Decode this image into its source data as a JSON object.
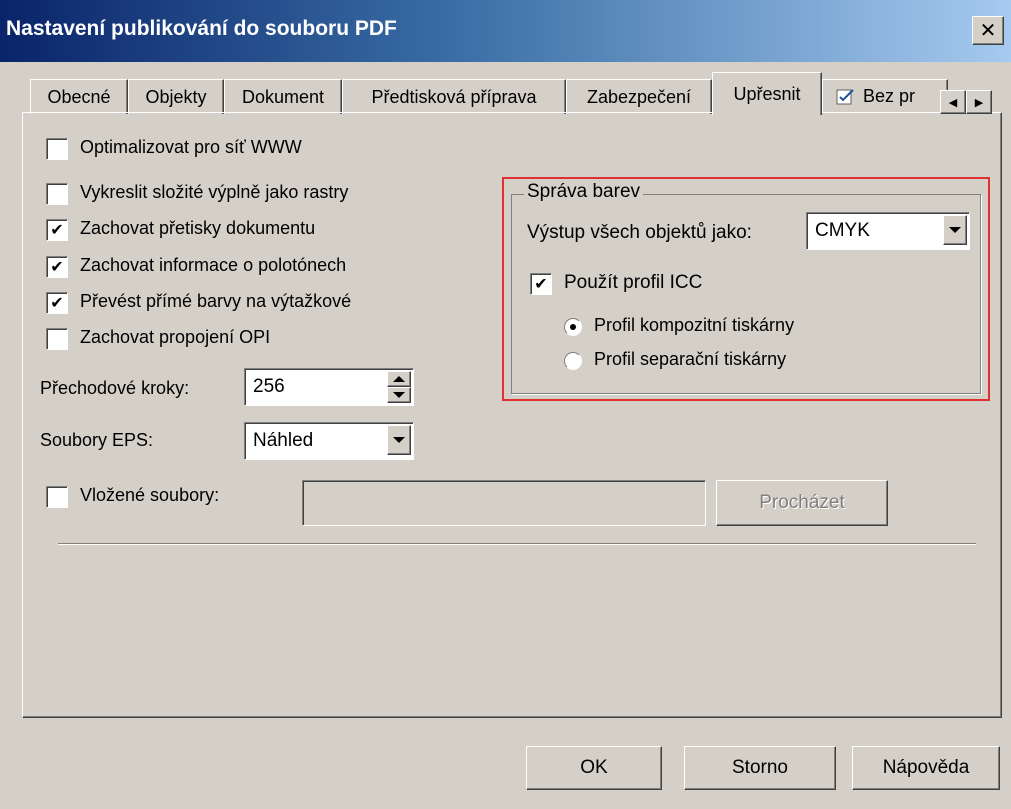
{
  "window": {
    "title": "Nastavení publikování do souboru PDF",
    "close_label": "✕"
  },
  "tabs": [
    {
      "label": "Obecné"
    },
    {
      "label": "Objekty"
    },
    {
      "label": "Dokument"
    },
    {
      "label": "Předtisková příprava"
    },
    {
      "label": "Zabezpečení"
    },
    {
      "label": "Upřesnit",
      "active": true
    },
    {
      "label": "Bez pr",
      "icon": "checkmark-document-icon"
    }
  ],
  "tab_scroll": {
    "left": "◀",
    "right": "▶"
  },
  "options": {
    "optimize_web": {
      "label": "Optimalizovat pro síť WWW",
      "checked": false
    },
    "render_complex_fills": {
      "label": "Vykreslit složité výplně jako rastry",
      "checked": false
    },
    "keep_overprints": {
      "label": "Zachovat přetisky dokumentu",
      "checked": true
    },
    "keep_halftone": {
      "label": "Zachovat informace o polotónech",
      "checked": true
    },
    "convert_spot": {
      "label": "Převést přímé barvy na výtažkové",
      "checked": true
    },
    "keep_opi": {
      "label": "Zachovat propojení OPI",
      "checked": false
    }
  },
  "gradient_steps": {
    "label": "Přechodové kroky:",
    "value": "256"
  },
  "eps_files": {
    "label": "Soubory EPS:",
    "value": "Náhled"
  },
  "embedded_files": {
    "label": "Vložené soubory:",
    "checked": false,
    "value": "",
    "browse_label": "Procházet"
  },
  "color_management": {
    "title": "Správa barev",
    "output_label": "Výstup všech objektů jako:",
    "output_value": "CMYK",
    "use_icc": {
      "label": "Použít profil ICC",
      "checked": true
    },
    "profiles": [
      {
        "label": "Profil kompozitní tiskárny",
        "selected": true
      },
      {
        "label": "Profil separační tiskárny",
        "selected": false
      }
    ]
  },
  "buttons": {
    "ok": "OK",
    "cancel": "Storno",
    "help": "Nápověda"
  },
  "check_mark": "✔",
  "colors": {
    "title_start": "#0a246a",
    "title_end": "#a6caf0",
    "face": "#d4d0c8",
    "highlight_border": "#e03030"
  }
}
